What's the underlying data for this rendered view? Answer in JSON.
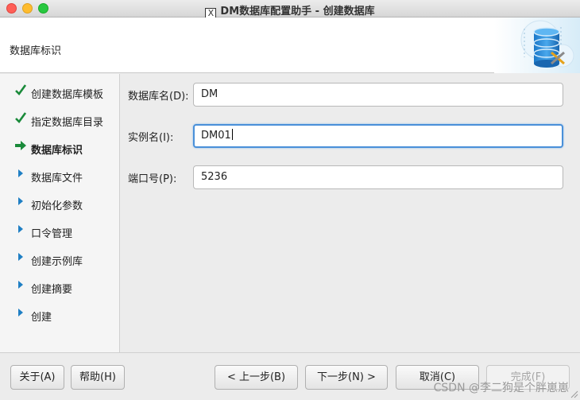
{
  "window": {
    "title": "DM数据库配置助手 - 创建数据库",
    "x_glyph": "X"
  },
  "header": {
    "title": "数据库标识",
    "logo_icon": "database-tools-icon"
  },
  "steps": [
    {
      "label": "创建数据库模板",
      "state": "done",
      "icon": "check-icon"
    },
    {
      "label": "指定数据库目录",
      "state": "done",
      "icon": "check-icon"
    },
    {
      "label": "数据库标识",
      "state": "current",
      "icon": "arrow-right-icon"
    },
    {
      "label": "数据库文件",
      "state": "pending",
      "icon": "triangle-right-icon"
    },
    {
      "label": "初始化参数",
      "state": "pending",
      "icon": "triangle-right-icon"
    },
    {
      "label": "口令管理",
      "state": "pending",
      "icon": "triangle-right-icon"
    },
    {
      "label": "创建示例库",
      "state": "pending",
      "icon": "triangle-right-icon"
    },
    {
      "label": "创建摘要",
      "state": "pending",
      "icon": "triangle-right-icon"
    },
    {
      "label": "创建",
      "state": "pending",
      "icon": "triangle-right-icon"
    }
  ],
  "form": {
    "db_name": {
      "label": "数据库名(D):",
      "value": "DM"
    },
    "instance_name": {
      "label": "实例名(I):",
      "value": "DM01"
    },
    "port": {
      "label": "端口号(P):",
      "value": "5236"
    }
  },
  "buttons": {
    "about": "关于(A)",
    "help": "帮助(H)",
    "prev": "< 上一步(B)",
    "next": "下一步(N) >",
    "cancel": "取消(C)",
    "finish": "完成(F)"
  },
  "watermark": "CSDN @李二狗是个胖崽崽",
  "colors": {
    "check": "#1a8a3a",
    "arrow": "#1a8a3a",
    "triangle": "#1f7fc4",
    "focus": "#4a90d9"
  }
}
